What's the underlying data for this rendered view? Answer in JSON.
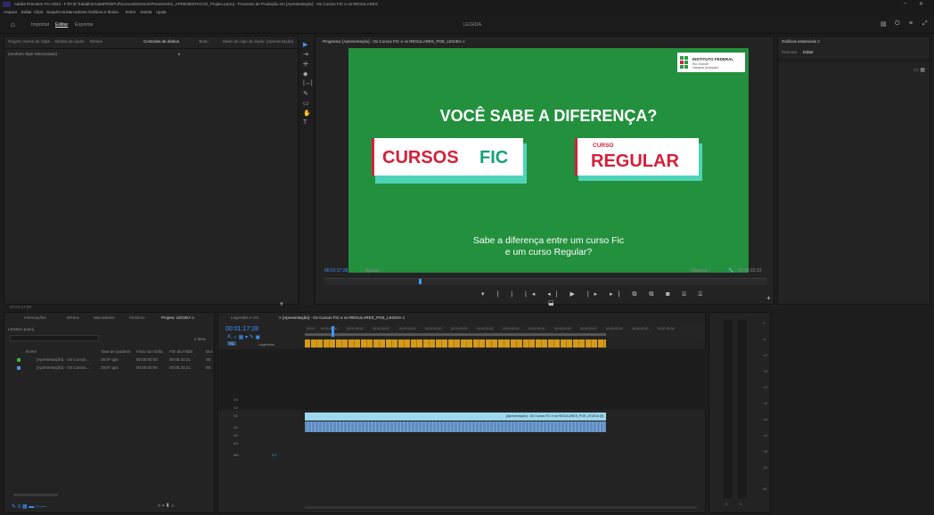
{
  "app": {
    "title": "Adobe Premiere Pro 2024 - F:\\Prof Trabalho\\AulaIFRN\\Prof\\Cursos\\Diretorio\\Premiere\\01_APRESENTACAO_Projeto.prproj - Processo de Produção em [Apresentação] - Os Cursos FIC e os REGULARES",
    "menu": [
      "Arquivo",
      "Editar",
      "Clipe",
      "Sequência",
      "Marcadores",
      "Gráficos e títulos",
      "Exibir",
      "Janela",
      "Ajuda"
    ],
    "workspaces": {
      "home": "⌂",
      "tabs": [
        "Importar",
        "Editar",
        "Exportar"
      ],
      "active": "Editar",
      "center": "LEGIDA"
    }
  },
  "effects_panel": {
    "tabs": [
      "Origem: Nome do Clipe",
      "Efeitos de áudio",
      "Efeitos",
      "Controles de efeitos",
      "Texto",
      "Mixer de clipe de áudio: [Apresentação]"
    ],
    "active": "Controles de efeitos",
    "subtitle": "(nenhum clipe selecionado)",
    "footer": "00:01:17:28"
  },
  "tools": [
    "▶",
    "⇥",
    "✢",
    "◆",
    "|↔|",
    "✎",
    "▭",
    "✋",
    "T"
  ],
  "program": {
    "header": "Programa: [Apresentação] - Os Cursos FIC e os REGULARES_PGE_LEGIDA ≡",
    "timecode": "00:01:17:28",
    "fit": "Ajustar",
    "quality": "Máxima",
    "duration": "00:05:33:22",
    "transport": "▾ | | |◂ ◂| ▶ |▸ ▸| ⧉ ⧉ ◙ ⌸ ⌺",
    "video": {
      "question": "VOCÊ SABE A DIFERENÇA?",
      "card_fic_1": "CURSOS",
      "card_fic_2": "FIC",
      "card_reg_small": "CURSO",
      "card_reg_big": "REGULAR",
      "badge_title": "INSTITUTO FEDERAL",
      "badge_line1": "Rio Grande",
      "badge_line2": "Campus Avançado",
      "subtitle_line1": "Sabe a diferença entre um curso Fic",
      "subtitle_line2": "e um curso Regular?"
    }
  },
  "essential_graphics": {
    "title": "Gráficos essenciais ≡",
    "tabs": [
      "Procurar",
      "Editar"
    ]
  },
  "project": {
    "tabs": [
      "Informações",
      "Efeitos",
      "Marcadores",
      "Histórico",
      "Projeto: LEGIDA ≡"
    ],
    "bin": "LEGIDA.prproj",
    "count": "2 itens",
    "columns": [
      "Nome",
      "Taxa de quadros",
      "Início da mídia",
      "Fim da mídia",
      "Dur"
    ],
    "items": [
      {
        "name": "[Apresentação] - Os Cursos...",
        "rate": "29,97 qps",
        "start": "00:00:00:00",
        "end": "00:05:33:21",
        "dur": "00:"
      },
      {
        "name": "[Apresentação] - Os Cursos...",
        "rate": "29,97 qps",
        "start": "00:00:00:00",
        "end": "00:05:33:21",
        "dur": "00:"
      }
    ]
  },
  "timeline": {
    "tabs": [
      "Legendas e OS",
      "× [Apresentação] - Os Cursos FIC e os REGULARES_PGE_LEGIDA ≡"
    ],
    "timecode": "00:01:17:28",
    "ruler": [
      "00:00",
      "00:00:30:00",
      "00:01:00:00",
      "00:01:30:00",
      "00:02:00:00",
      "00:02:30:00",
      "00:03:00:00",
      "00:03:30:00",
      "00:04:00:00",
      "00:04:30:00",
      "00:05:00:00",
      "00:05:30:00",
      "00:06:00:00",
      "00:06:30:00",
      "00:07:00:00"
    ],
    "video_track": "Legendas",
    "tracks": [
      "V3",
      "V2",
      "V1",
      "A1",
      "A2",
      "A3",
      "Mix"
    ],
    "audio_clip": "[Apresentação] - Os Cursos FIC e os REGULARES_PGE_LEGIDA [V]",
    "mix_value": "0,0"
  },
  "meters": {
    "labels": [
      "0",
      "-6",
      "-12",
      "-18",
      "-24",
      "-30",
      "-36",
      "-42",
      "-48",
      "-54",
      "dB"
    ],
    "channels": [
      "S",
      "S"
    ]
  },
  "colors": {
    "accent_blue": "#3f97ff",
    "video_green": "#23903e",
    "clip_gold": "#d49a1a",
    "audio_blue": "#9ed8ed"
  }
}
